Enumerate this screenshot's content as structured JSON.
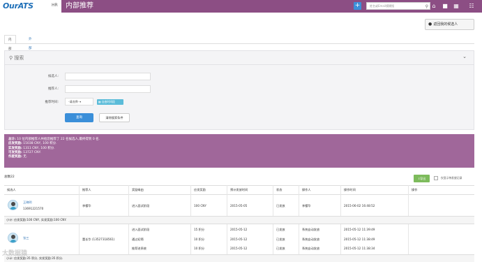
{
  "header": {
    "logo_text": "OurATS",
    "role": "HR",
    "page_title": "内部推荐",
    "search_placeholder": "姓名或Email模糊搜",
    "accent_color": "#8c4e84",
    "icons": [
      "plus-icon",
      "search-icon",
      "home-icon",
      "shirt-icon",
      "calendar-icon",
      "grid-icon"
    ]
  },
  "tabs": [
    {
      "label": "内部推荐",
      "active": true
    },
    {
      "label": "外部推荐",
      "active": false
    }
  ],
  "back_button": "返回我的候选人",
  "search_panel": {
    "title": "搜索",
    "candidate_label": "候选人:",
    "referrer_label": "推荐人:",
    "time_label": "推荐时间:",
    "time_select": "-请选择-",
    "date_button": "自由时间段",
    "search_button": "查询",
    "clear_button": "清除搜索条件"
  },
  "summary": {
    "line1_label": "总计:",
    "line1_text": "10 位内部推荐人共给您推荐了 22 名候选人,最终得到 0 名.",
    "line2_label": "应发奖励:",
    "line2_text": "15038 CNY, 100 积分.",
    "line3_label": "实发奖励:",
    "line3_text": "1311 CNY, 100 积分.",
    "line4_label": "可发奖励:",
    "line4_text": "13727 CNY.",
    "line5_label": "作废奖励:",
    "line5_text": "无."
  },
  "list": {
    "total": "总数22",
    "export_button": "导出",
    "only_show_label": "仅显示待发放记录",
    "columns": [
      "候选人",
      "推荐人",
      "奖励缘由",
      "应发奖励",
      "预计发放时间",
      "状态",
      "操作人",
      "操作时间",
      "操作"
    ]
  },
  "rows": [
    {
      "candidate_name": "王晓明",
      "candidate_phone": "13691221570",
      "referrer": "李樱华",
      "items": [
        {
          "reason": "进入面试阶段",
          "reward": "100 CNY",
          "date": "2015-05-05",
          "status": "已发放",
          "operator": "李樱华",
          "op_time": "2015-06-02 16:48:52"
        }
      ],
      "subtotal": "小计: 应发奖励:100 CNY, 实发奖励:100 CNY."
    },
    {
      "candidate_name": "张三",
      "candidate_phone": "",
      "referrer": "董长华 (13527318561)",
      "items": [
        {
          "reason": "进入面试阶段",
          "reward": "15 积分",
          "date": "2015-05-12",
          "status": "已发放",
          "operator": "系统自动发放",
          "op_time": "2015-05-12 11:39:49"
        },
        {
          "reason": "通过初筛",
          "reward": "10 积分",
          "date": "2015-05-12",
          "status": "已发放",
          "operator": "系统自动发放",
          "op_time": "2015-05-12 11:38:49"
        },
        {
          "reason": "推荐进系统",
          "reward": "10 积分",
          "date": "2015-05-12",
          "status": "已发放",
          "operator": "系统自动发放",
          "op_time": "2015-05-12 11:38:34"
        }
      ],
      "subtotal": "小计: 应发奖励:35 积分, 实发奖励:35 积分."
    }
  ],
  "watermark": "大数据猿"
}
